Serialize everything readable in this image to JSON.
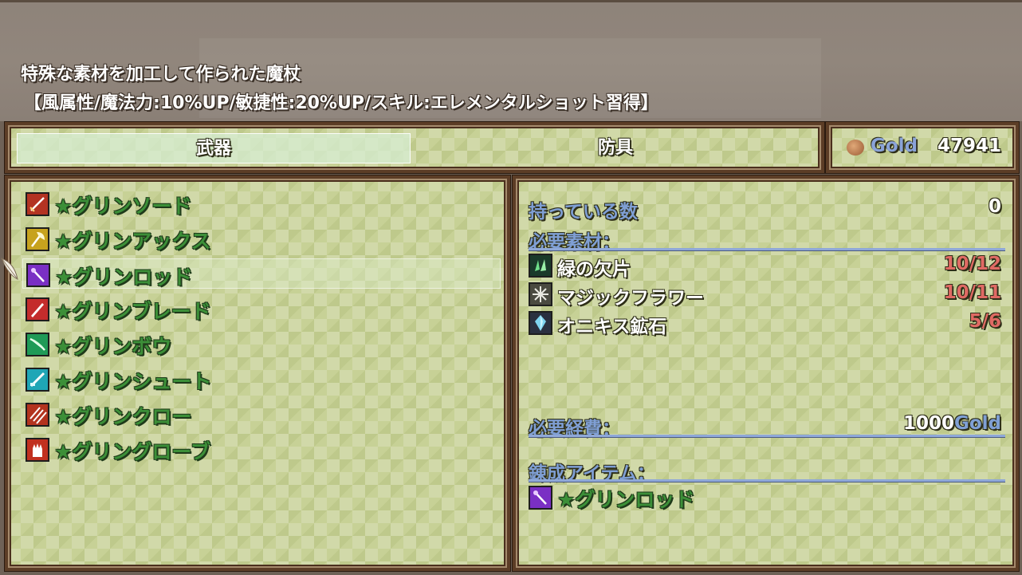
{
  "help": {
    "line1": "特殊な素材を加工して作られた魔杖",
    "line2": "【風属性/魔法力:10%UP/敏捷性:20%UP/スキル:エレメンタルショット習得】"
  },
  "categories": {
    "weapons": "武器",
    "armor": "防具"
  },
  "gold": {
    "unit": "Gold",
    "amount": "47941",
    "icon": "coin-icon"
  },
  "items": [
    {
      "name": "★グリンソード",
      "icon": "sword-icon",
      "color": "#b33322"
    },
    {
      "name": "★グリンアックス",
      "icon": "axe-icon",
      "color": "#c7a21e"
    },
    {
      "name": "★グリンロッド",
      "icon": "rod-icon",
      "color": "#7a2fc4"
    },
    {
      "name": "★グリンブレード",
      "icon": "blade-icon",
      "color": "#c42c2c"
    },
    {
      "name": "★グリンボウ",
      "icon": "bow-icon",
      "color": "#1f9a57"
    },
    {
      "name": "★グリンシュート",
      "icon": "gun-icon",
      "color": "#1fa6b6"
    },
    {
      "name": "★グリンクロー",
      "icon": "claw-icon",
      "color": "#b3331e"
    },
    {
      "name": "★グリングローブ",
      "icon": "glove-icon",
      "color": "#c1301f"
    }
  ],
  "selected_index": 2,
  "info": {
    "owned_label": "持っている数",
    "owned_value": "0",
    "materials_label": "必要素材：",
    "materials": [
      {
        "name": "緑の欠片",
        "count": "10/12",
        "icon": "green-shard-icon"
      },
      {
        "name": "マジックフラワー",
        "count": "10/11",
        "icon": "magic-flower-icon"
      },
      {
        "name": "オニキス鉱石",
        "count": "5/6",
        "icon": "onyx-ore-icon"
      }
    ],
    "cost_label": "必要経費：",
    "cost_value": "1000",
    "cost_unit": "Gold",
    "result_label": "錬成アイテム：",
    "result_name": "★グリンロッド",
    "result_icon": "rod-icon"
  }
}
